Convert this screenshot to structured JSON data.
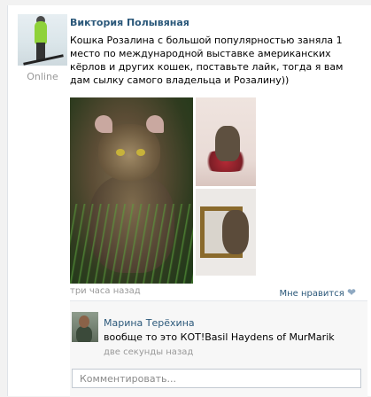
{
  "post": {
    "author": "Виктория Полывяная",
    "status": "Online",
    "text": "Кошка Розалина с большой популярностью заняла 1 место по международной выставке американских кёрлов и других кошек, поставьте лайк, тогда я вам дам сылку самого владельца и Розалину))",
    "time": "три часа назад",
    "like_label": "Мне нравится",
    "like_icon": "heart-icon"
  },
  "comment": {
    "author": "Марина Терёхина",
    "text": "вообще то это КОТ!Basil Haydens of MurMarik",
    "time": "две секунды назад"
  },
  "comment_input": {
    "placeholder": "Комментировать..."
  },
  "colors": {
    "link": "#2b587a",
    "muted": "#999999"
  }
}
